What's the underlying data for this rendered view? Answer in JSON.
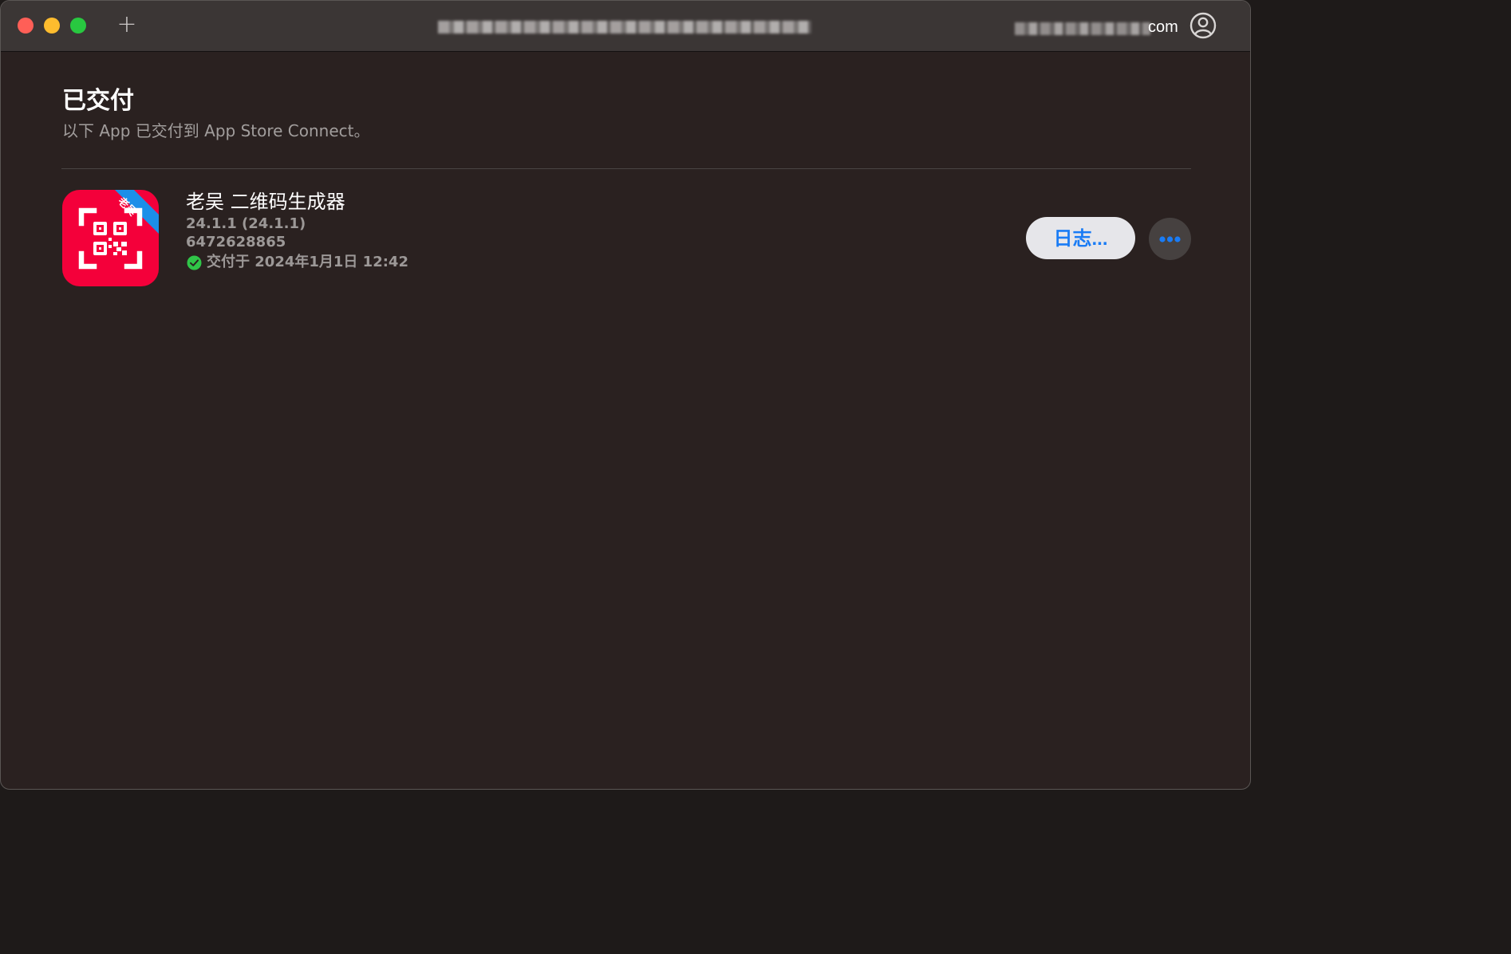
{
  "titlebar": {
    "account_suffix": "com"
  },
  "main": {
    "heading": "已交付",
    "subheading": "以下 App 已交付到 App Store Connect。"
  },
  "app": {
    "ribbon_text": "老吴",
    "name": "老吴 二维码生成器",
    "version": "24.1.1 (24.1.1)",
    "id": "6472628865",
    "status": "交付于 2024年1月1日 12:42",
    "log_button_label": "日志..."
  },
  "colors": {
    "accent": "#1a7cf5",
    "success": "#30c548",
    "app_icon_bg": "#f4003a",
    "ribbon": "#1b8fe8"
  },
  "icons": {
    "plus": "plus-icon",
    "account": "account-circle-icon",
    "status": "checkmark-circle-icon",
    "more": "ellipsis-icon",
    "app": "qr-code-icon"
  }
}
